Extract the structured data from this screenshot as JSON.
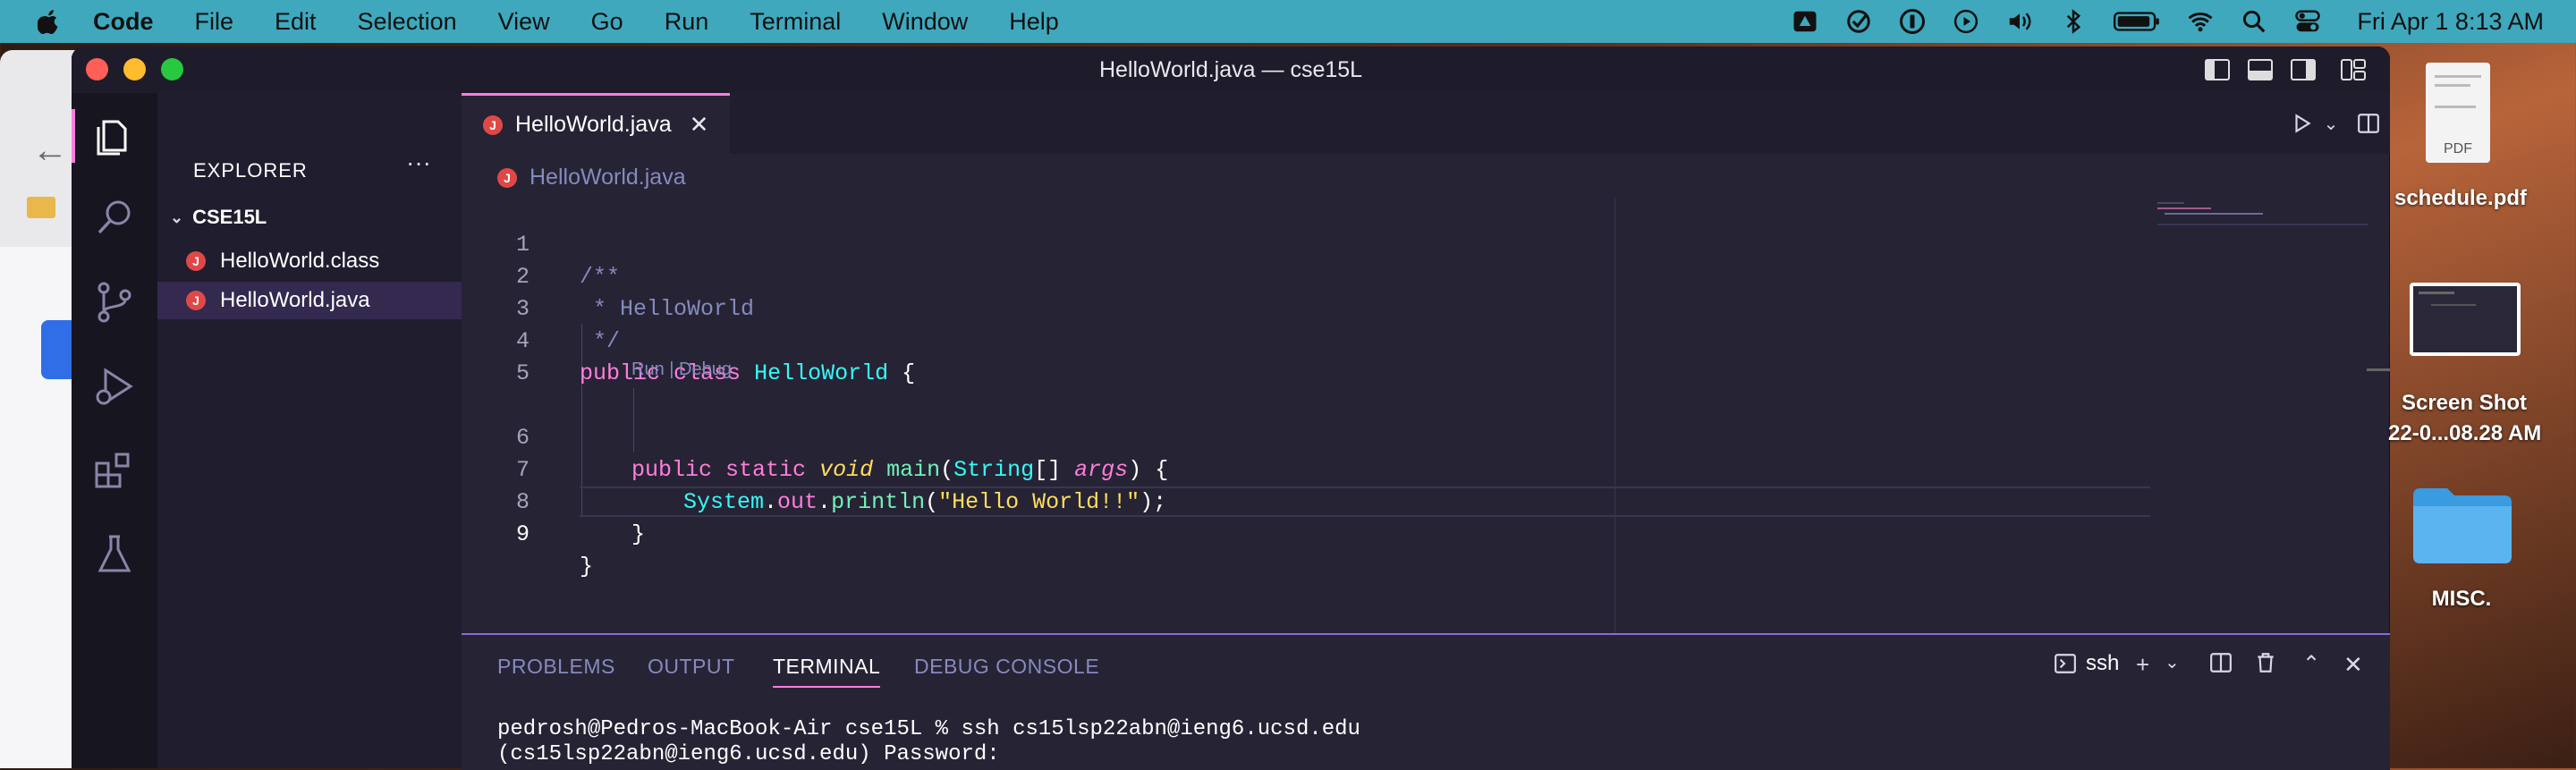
{
  "menubar": {
    "app": "Code",
    "items": [
      "File",
      "Edit",
      "Selection",
      "View",
      "Go",
      "Run",
      "Terminal",
      "Window",
      "Help"
    ],
    "clock": "Fri Apr 1  8:13 AM",
    "status_icons": [
      "drive-icon",
      "checkmark-icon",
      "onepassword-icon",
      "play-circle-icon",
      "volume-icon",
      "bluetooth-icon",
      "battery-icon",
      "wifi-icon",
      "spotlight-icon",
      "control-center-icon"
    ]
  },
  "window": {
    "title": "HelloWorld.java — cse15L",
    "traffic_colors": [
      "#ff5f57",
      "#febc2e",
      "#28c840"
    ]
  },
  "sidebar": {
    "title": "EXPLORER",
    "folder": "CSE15L",
    "files": [
      {
        "name": "HelloWorld.class",
        "badge": "J"
      },
      {
        "name": "HelloWorld.java",
        "badge": "J"
      }
    ]
  },
  "tab": {
    "label": "HelloWorld.java",
    "badge": "J"
  },
  "breadcrumb": {
    "label": "HelloWorld.java"
  },
  "editor": {
    "line_numbers": [
      "1",
      "2",
      "3",
      "4",
      "5",
      "6",
      "7",
      "8",
      "9"
    ],
    "codelens": "Run | Debug",
    "lines": {
      "l1": "/**",
      "l2": " * HelloWorld",
      "l3": " */",
      "l4_kw1": "public",
      "l4_kw2": "class",
      "l4_name": "HelloWorld",
      "l4_brace": "{",
      "l6_kw1": "public",
      "l6_kw2": "static",
      "l6_type": "void",
      "l6_fn": "main",
      "l6_open": "(",
      "l6_ptype": "String",
      "l6_arr": "[]",
      "l6_param": "args",
      "l6_close": ") {",
      "l7_obj": "System",
      "l7_dot1": ".",
      "l7_field": "out",
      "l7_dot2": ".",
      "l7_fn": "println",
      "l7_open": "(",
      "l7_str": "\"Hello World!!\"",
      "l7_close": ");",
      "l8": "}",
      "l9": "}"
    }
  },
  "panel": {
    "tabs": [
      "PROBLEMS",
      "OUTPUT",
      "TERMINAL",
      "DEBUG CONSOLE"
    ],
    "active_tab": "TERMINAL",
    "terminal_name": "ssh",
    "terminal_lines": [
      "pedrosh@Pedros-MacBook-Air cse15L % ssh cs15lsp22abn@ieng6.ucsd.edu",
      "(cs15lsp22abn@ieng6.ucsd.edu) Password:"
    ]
  },
  "desktop": {
    "items": [
      {
        "label": "schedule.pdf",
        "badge": "PDF"
      },
      {
        "label_line1": "Screen Shot",
        "label_line2": "22-0...08.28 AM"
      },
      {
        "label": "MISC."
      }
    ]
  },
  "colors": {
    "accent": "#ff7edb",
    "menubar": "#3fa8bd",
    "editor_bg": "#262335",
    "java_badge": "#e04848"
  }
}
